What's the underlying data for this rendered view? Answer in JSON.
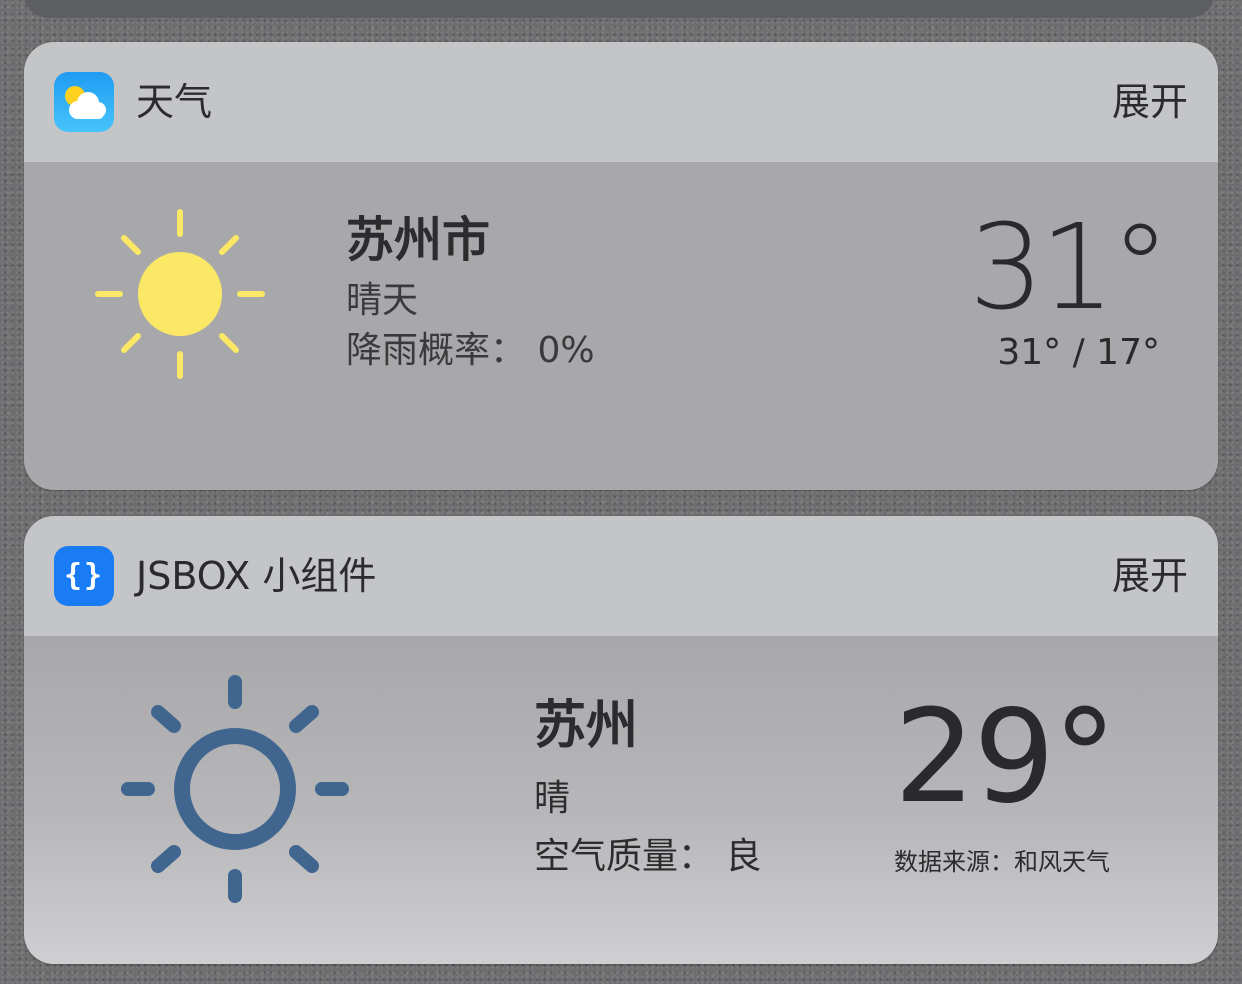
{
  "colors": {
    "sun_yellow": "#fbe866",
    "sun_blue": "#40658f",
    "weather_icon_blue": "#1f9cf3",
    "jsbox_icon_blue": "#1a7cf5"
  },
  "widgets": [
    {
      "app_name": "天气",
      "app_icon": "weather-app-icon",
      "expand_label": "展开",
      "weather_icon": "sun-icon",
      "city": "苏州市",
      "condition": "晴天",
      "rain_label": "降雨概率：",
      "rain_value": "0%",
      "temperature": "31°",
      "range": "31° / 17°"
    },
    {
      "app_name": "JSBOX 小组件",
      "app_icon": "jsbox-app-icon",
      "app_icon_glyph": "{}",
      "expand_label": "展开",
      "weather_icon": "sun-outline-icon",
      "city": "苏州",
      "condition": "晴",
      "aqi_label": "空气质量：",
      "aqi_value": "良",
      "temperature": "29°",
      "source": "数据来源：和风天气"
    }
  ]
}
